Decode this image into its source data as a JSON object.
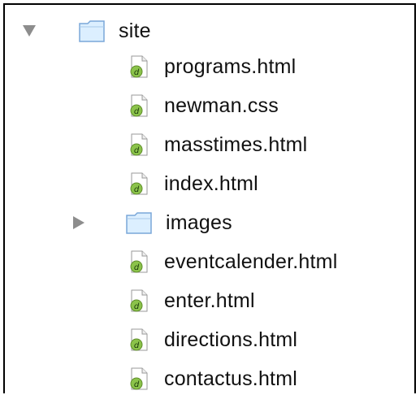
{
  "tree": {
    "root": {
      "label": "site",
      "expanded": true,
      "icon": "folder-icon",
      "children": [
        {
          "label": "programs.html",
          "icon": "dreamweaver-file-icon"
        },
        {
          "label": "newman.css",
          "icon": "dreamweaver-file-icon"
        },
        {
          "label": "masstimes.html",
          "icon": "dreamweaver-file-icon"
        },
        {
          "label": "index.html",
          "icon": "dreamweaver-file-icon"
        },
        {
          "label": "images",
          "icon": "folder-icon",
          "expanded": false
        },
        {
          "label": "eventcalender.html",
          "icon": "dreamweaver-file-icon"
        },
        {
          "label": "enter.html",
          "icon": "dreamweaver-file-icon"
        },
        {
          "label": "directions.html",
          "icon": "dreamweaver-file-icon"
        },
        {
          "label": "contactus.html",
          "icon": "dreamweaver-file-icon"
        }
      ]
    }
  },
  "colors": {
    "disclosure": "#8d8d8d",
    "folder_light": "#dcefff",
    "folder_dark": "#7aa7d9",
    "file_badge": "#8bc34a"
  }
}
